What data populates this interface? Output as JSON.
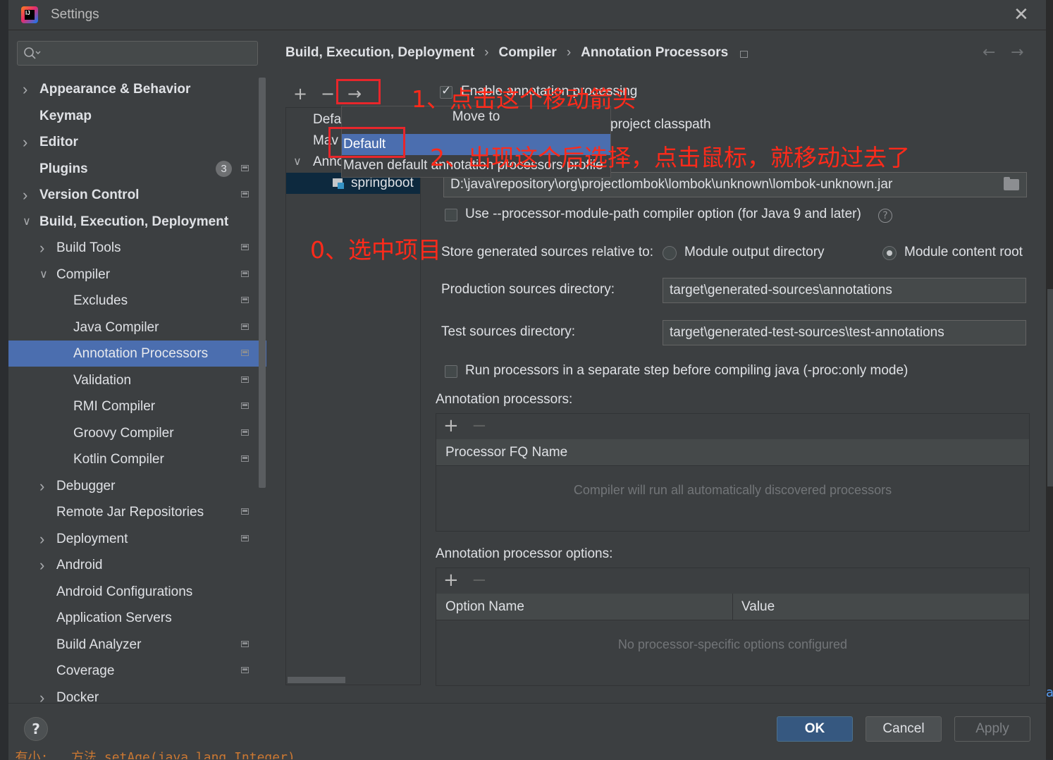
{
  "window": {
    "title": "Settings"
  },
  "search": {
    "value": "",
    "placeholder": ""
  },
  "sidebar": {
    "items": [
      {
        "label": "Appearance & Behavior",
        "bold": true,
        "expand": "collapsed",
        "indent": 0,
        "cfg": false
      },
      {
        "label": "Keymap",
        "bold": true,
        "expand": "none",
        "indent": 0,
        "cfg": false
      },
      {
        "label": "Editor",
        "bold": true,
        "expand": "collapsed",
        "indent": 0,
        "cfg": false
      },
      {
        "label": "Plugins",
        "bold": true,
        "expand": "none",
        "indent": 0,
        "cfg": true,
        "badge": "3"
      },
      {
        "label": "Version Control",
        "bold": true,
        "expand": "collapsed",
        "indent": 0,
        "cfg": true
      },
      {
        "label": "Build, Execution, Deployment",
        "bold": true,
        "expand": "expanded",
        "indent": 0,
        "cfg": false
      },
      {
        "label": "Build Tools",
        "bold": false,
        "expand": "collapsed",
        "indent": 1,
        "cfg": true
      },
      {
        "label": "Compiler",
        "bold": false,
        "expand": "expanded",
        "indent": 1,
        "cfg": true
      },
      {
        "label": "Excludes",
        "bold": false,
        "expand": "none",
        "indent": 2,
        "cfg": true
      },
      {
        "label": "Java Compiler",
        "bold": false,
        "expand": "none",
        "indent": 2,
        "cfg": true
      },
      {
        "label": "Annotation Processors",
        "bold": false,
        "expand": "none",
        "indent": 2,
        "cfg": true,
        "selected": true
      },
      {
        "label": "Validation",
        "bold": false,
        "expand": "none",
        "indent": 2,
        "cfg": true
      },
      {
        "label": "RMI Compiler",
        "bold": false,
        "expand": "none",
        "indent": 2,
        "cfg": true
      },
      {
        "label": "Groovy Compiler",
        "bold": false,
        "expand": "none",
        "indent": 2,
        "cfg": true
      },
      {
        "label": "Kotlin Compiler",
        "bold": false,
        "expand": "none",
        "indent": 2,
        "cfg": true
      },
      {
        "label": "Debugger",
        "bold": false,
        "expand": "collapsed",
        "indent": 1,
        "cfg": false
      },
      {
        "label": "Remote Jar Repositories",
        "bold": false,
        "expand": "none",
        "indent": 1,
        "cfg": true
      },
      {
        "label": "Deployment",
        "bold": false,
        "expand": "collapsed",
        "indent": 1,
        "cfg": true
      },
      {
        "label": "Android",
        "bold": false,
        "expand": "collapsed",
        "indent": 1,
        "cfg": false
      },
      {
        "label": "Android Configurations",
        "bold": false,
        "expand": "none",
        "indent": 1,
        "cfg": false
      },
      {
        "label": "Application Servers",
        "bold": false,
        "expand": "none",
        "indent": 1,
        "cfg": false
      },
      {
        "label": "Build Analyzer",
        "bold": false,
        "expand": "none",
        "indent": 1,
        "cfg": true
      },
      {
        "label": "Coverage",
        "bold": false,
        "expand": "none",
        "indent": 1,
        "cfg": true
      },
      {
        "label": "Docker",
        "bold": false,
        "expand": "collapsed",
        "indent": 1,
        "cfg": false
      }
    ]
  },
  "breadcrumb": {
    "part1": "Build, Execution, Deployment",
    "part2": "Compiler",
    "part3": "Annotation Processors",
    "sep": "›"
  },
  "profiles": {
    "toolbar": {
      "add": "+",
      "remove": "−",
      "move": "→"
    },
    "rows": [
      "Defa",
      "Mav",
      "Anno",
      "springboot"
    ]
  },
  "popup": {
    "title": "Move to",
    "items": [
      "Default",
      "Maven default annotation processors profile"
    ]
  },
  "form": {
    "enable_label": "Enable annotation processing",
    "classpath_label": "project classpath",
    "processor_path": "D:\\java\\repository\\org\\projectlombok\\lombok\\unknown\\lombok-unknown.jar",
    "module_path_label": "Use --processor-module-path compiler option (for Java 9 and later)",
    "help": "?",
    "store_label": "Store generated sources relative to:",
    "radio_output": "Module output directory",
    "radio_content": "Module content root",
    "prod_label": "Production sources directory:",
    "prod_value": "target\\generated-sources\\annotations",
    "test_label": "Test sources directory:",
    "test_value": "target\\generated-test-sources\\test-annotations",
    "separate_step_label": "Run processors in a separate step before compiling java (-proc:only mode)"
  },
  "processors_table": {
    "title": "Annotation processors:",
    "add": "+",
    "remove": "−",
    "column": "Processor FQ Name",
    "empty": "Compiler will run all automatically discovered processors"
  },
  "options_table": {
    "title": "Annotation processor options:",
    "add": "+",
    "remove": "−",
    "col_name": "Option Name",
    "col_value": "Value",
    "empty": "No processor-specific options configured"
  },
  "footer": {
    "help": "?",
    "ok": "OK",
    "cancel": "Cancel",
    "apply": "Apply"
  },
  "annotations": {
    "step0": "0、选中项目",
    "step1": "1、点击这个移动箭头",
    "step2": "2、出现这个后选择，点击鼠标，就移动过去了"
  },
  "background": {
    "code_fragment": "  有小:   方法 setAge(java.lang.Integer)",
    "right_link": "a"
  },
  "colors": {
    "accent": "#4b6eaf",
    "annotation_red": "#e8262b",
    "ok_button": "#365880"
  }
}
